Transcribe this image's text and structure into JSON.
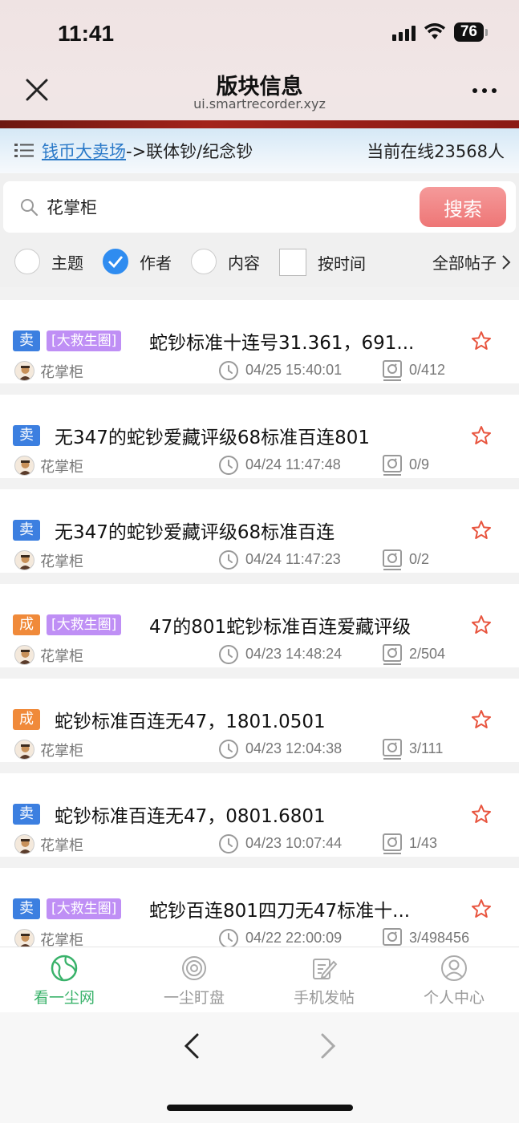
{
  "status": {
    "time": "11:41",
    "battery": "76"
  },
  "header": {
    "title": "版块信息",
    "subtitle": "ui.smartrecorder.xyz"
  },
  "breadcrumb": {
    "link": "钱币大卖场",
    "path": "->联体钞/纪念钞",
    "online": "当前在线23568人"
  },
  "search": {
    "value": "花掌柜",
    "button": "搜索"
  },
  "filters": {
    "opt1": "主题",
    "opt2": "作者",
    "opt3": "内容",
    "opt4": "按时间",
    "all_posts": "全部帖子"
  },
  "posts": [
    {
      "badge": "卖",
      "tag": "[大救生圈]",
      "title": "蛇钞标准十连号31.361，691...",
      "author": "花掌柜",
      "time": "04/25 15:40:01",
      "counts": "0/412"
    },
    {
      "badge": "卖",
      "tag": "",
      "title": "无347的蛇钞爱藏评级68标准百连801",
      "author": "花掌柜",
      "time": "04/24 11:47:48",
      "counts": "0/9"
    },
    {
      "badge": "卖",
      "tag": "",
      "title": "无347的蛇钞爱藏评级68标准百连",
      "author": "花掌柜",
      "time": "04/24 11:47:23",
      "counts": "0/2"
    },
    {
      "badge": "成",
      "tag": "[大救生圈]",
      "title": "47的801蛇钞标准百连爱藏评级",
      "author": "花掌柜",
      "time": "04/23 14:48:24",
      "counts": "2/504"
    },
    {
      "badge": "成",
      "tag": "",
      "title": "蛇钞标准百连无47，1801.0501",
      "author": "花掌柜",
      "time": "04/23 12:04:38",
      "counts": "3/111"
    },
    {
      "badge": "卖",
      "tag": "",
      "title": "蛇钞标准百连无47，0801.6801",
      "author": "花掌柜",
      "time": "04/23 10:07:44",
      "counts": "1/43"
    },
    {
      "badge": "卖",
      "tag": "[大救生圈]",
      "title": "蛇钞百连801四刀无47标准十...",
      "author": "花掌柜",
      "time": "04/22 22:00:09",
      "counts": "3/498456"
    }
  ],
  "tabs": {
    "t1": "看一尘网",
    "t2": "一尘盯盘",
    "t3": "手机发帖",
    "t4": "个人中心"
  },
  "colors": {
    "accent": "#2f8cf0",
    "sell": "#3c7fe0",
    "done": "#f08a3a",
    "tag": "#bf8ff5",
    "active_tab": "#39b26a",
    "search_btn": "#ee7676",
    "star": "#e8553f"
  }
}
